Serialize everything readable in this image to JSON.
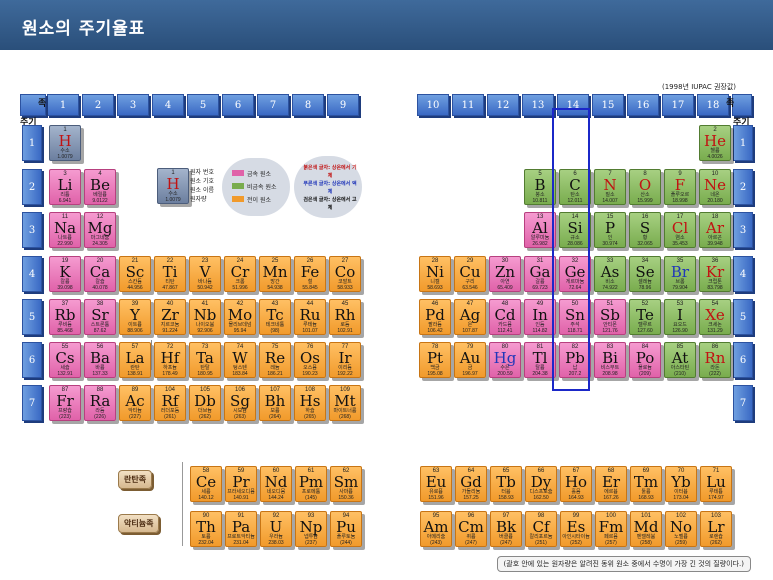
{
  "window": {
    "title": "원소의 주기율표"
  },
  "labels": {
    "group_caption": "족",
    "period_caption": "주기",
    "iupac_note": "(1998년 IUPAC 권장값)",
    "lanthanide_badge": "란탄족",
    "actinide_badge": "악티늄족",
    "footnote": "(괄호 안에 있는 원자량은 알려진 동위 원소 중에서 수명이 가장 긴 것의 질량이다.)"
  },
  "groups": [
    "1",
    "2",
    "3",
    "4",
    "5",
    "6",
    "7",
    "8",
    "9",
    "10",
    "11",
    "12",
    "13",
    "14",
    "15",
    "16",
    "17",
    "18"
  ],
  "periods": [
    "1",
    "2",
    "3",
    "4",
    "5",
    "6",
    "7"
  ],
  "legend": {
    "sample": {
      "number": "1",
      "symbol": "H",
      "name": "수소",
      "mass": "1.0079"
    },
    "lines": [
      "원자 번호",
      "원소 기호",
      "원소 이름",
      "원자량"
    ],
    "categories": [
      "금속 원소",
      "비금속 원소",
      "전이 원소"
    ],
    "color_notes": [
      "붉은색 글자: 상온에서 기체",
      "푸른색 글자: 상온에서 액체",
      "검은색 글자: 상온에서 고체"
    ],
    "colors": {
      "metal": "#e062a9",
      "nonmetal": "#79ac4e",
      "transition": "#f19a2b"
    }
  },
  "elements": [
    {
      "n": "1",
      "s": "H",
      "k": "수소",
      "m": "1.0079",
      "c": "gray",
      "t": "red"
    },
    {
      "n": "2",
      "s": "He",
      "k": "헬륨",
      "m": "4.0026",
      "c": "green",
      "t": "red"
    },
    {
      "n": "3",
      "s": "Li",
      "k": "리튬",
      "m": "6.941",
      "c": "pink",
      "t": "blk"
    },
    {
      "n": "4",
      "s": "Be",
      "k": "베릴륨",
      "m": "9.0122",
      "c": "pink",
      "t": "blk"
    },
    {
      "n": "5",
      "s": "B",
      "k": "붕소",
      "m": "10.811",
      "c": "green",
      "t": "blk"
    },
    {
      "n": "6",
      "s": "C",
      "k": "탄소",
      "m": "12.011",
      "c": "green",
      "t": "blk"
    },
    {
      "n": "7",
      "s": "N",
      "k": "질소",
      "m": "14.007",
      "c": "green",
      "t": "red"
    },
    {
      "n": "8",
      "s": "O",
      "k": "산소",
      "m": "15.999",
      "c": "green",
      "t": "red"
    },
    {
      "n": "9",
      "s": "F",
      "k": "플루오르",
      "m": "18.998",
      "c": "green",
      "t": "red"
    },
    {
      "n": "10",
      "s": "Ne",
      "k": "네온",
      "m": "20.180",
      "c": "green",
      "t": "red"
    },
    {
      "n": "11",
      "s": "Na",
      "k": "나트륨",
      "m": "22.990",
      "c": "pink",
      "t": "blk"
    },
    {
      "n": "12",
      "s": "Mg",
      "k": "마그네슘",
      "m": "24.305",
      "c": "pink",
      "t": "blk"
    },
    {
      "n": "13",
      "s": "Al",
      "k": "알루미늄",
      "m": "26.982",
      "c": "pink",
      "t": "blk"
    },
    {
      "n": "14",
      "s": "Si",
      "k": "규소",
      "m": "28.086",
      "c": "green",
      "t": "blk"
    },
    {
      "n": "15",
      "s": "P",
      "k": "인",
      "m": "30.974",
      "c": "green",
      "t": "blk"
    },
    {
      "n": "16",
      "s": "S",
      "k": "황",
      "m": "32.065",
      "c": "green",
      "t": "blk"
    },
    {
      "n": "17",
      "s": "Cl",
      "k": "염소",
      "m": "35.453",
      "c": "green",
      "t": "red"
    },
    {
      "n": "18",
      "s": "Ar",
      "k": "아르곤",
      "m": "39.948",
      "c": "green",
      "t": "red"
    },
    {
      "n": "19",
      "s": "K",
      "k": "칼륨",
      "m": "39.098",
      "c": "pink",
      "t": "blk"
    },
    {
      "n": "20",
      "s": "Ca",
      "k": "칼슘",
      "m": "40.078",
      "c": "pink",
      "t": "blk"
    },
    {
      "n": "21",
      "s": "Sc",
      "k": "스칸듐",
      "m": "44.956",
      "c": "orange",
      "t": "blk"
    },
    {
      "n": "22",
      "s": "Ti",
      "k": "티탄",
      "m": "47.867",
      "c": "orange",
      "t": "blk"
    },
    {
      "n": "23",
      "s": "V",
      "k": "바나듐",
      "m": "50.942",
      "c": "orange",
      "t": "blk"
    },
    {
      "n": "24",
      "s": "Cr",
      "k": "크롬",
      "m": "51.996",
      "c": "orange",
      "t": "blk"
    },
    {
      "n": "25",
      "s": "Mn",
      "k": "망간",
      "m": "54.938",
      "c": "orange",
      "t": "blk"
    },
    {
      "n": "26",
      "s": "Fe",
      "k": "철",
      "m": "55.845",
      "c": "orange",
      "t": "blk"
    },
    {
      "n": "27",
      "s": "Co",
      "k": "코발트",
      "m": "58.933",
      "c": "orange",
      "t": "blk"
    },
    {
      "n": "28",
      "s": "Ni",
      "k": "니켈",
      "m": "58.693",
      "c": "orange",
      "t": "blk"
    },
    {
      "n": "29",
      "s": "Cu",
      "k": "구리",
      "m": "63.546",
      "c": "orange",
      "t": "blk"
    },
    {
      "n": "30",
      "s": "Zn",
      "k": "아연",
      "m": "65.409",
      "c": "pink",
      "t": "blk"
    },
    {
      "n": "31",
      "s": "Ga",
      "k": "갈륨",
      "m": "69.723",
      "c": "pink",
      "t": "blk"
    },
    {
      "n": "32",
      "s": "Ge",
      "k": "게르마늄",
      "m": "72.64",
      "c": "pink",
      "t": "blk"
    },
    {
      "n": "33",
      "s": "As",
      "k": "비소",
      "m": "74.922",
      "c": "green",
      "t": "blk"
    },
    {
      "n": "34",
      "s": "Se",
      "k": "셀레늄",
      "m": "78.96",
      "c": "green",
      "t": "blk"
    },
    {
      "n": "35",
      "s": "Br",
      "k": "브롬",
      "m": "79.904",
      "c": "green",
      "t": "blue"
    },
    {
      "n": "36",
      "s": "Kr",
      "k": "크립톤",
      "m": "83.798",
      "c": "green",
      "t": "red"
    },
    {
      "n": "37",
      "s": "Rb",
      "k": "루비듐",
      "m": "85.468",
      "c": "pink",
      "t": "blk"
    },
    {
      "n": "38",
      "s": "Sr",
      "k": "스트론튬",
      "m": "87.62",
      "c": "pink",
      "t": "blk"
    },
    {
      "n": "39",
      "s": "Y",
      "k": "이트륨",
      "m": "88.906",
      "c": "orange",
      "t": "blk"
    },
    {
      "n": "40",
      "s": "Zr",
      "k": "지르코늄",
      "m": "91.224",
      "c": "orange",
      "t": "blk"
    },
    {
      "n": "41",
      "s": "Nb",
      "k": "나이오븀",
      "m": "92.906",
      "c": "orange",
      "t": "blk"
    },
    {
      "n": "42",
      "s": "Mo",
      "k": "몰리브데넘",
      "m": "95.94",
      "c": "orange",
      "t": "blk"
    },
    {
      "n": "43",
      "s": "Tc",
      "k": "테크네튬",
      "m": "(98)",
      "c": "orange",
      "t": "blk"
    },
    {
      "n": "44",
      "s": "Ru",
      "k": "루테늄",
      "m": "101.07",
      "c": "orange",
      "t": "blk"
    },
    {
      "n": "45",
      "s": "Rh",
      "k": "로듐",
      "m": "102.91",
      "c": "orange",
      "t": "blk"
    },
    {
      "n": "46",
      "s": "Pd",
      "k": "팔라듐",
      "m": "106.42",
      "c": "orange",
      "t": "blk"
    },
    {
      "n": "47",
      "s": "Ag",
      "k": "은",
      "m": "107.87",
      "c": "orange",
      "t": "blk"
    },
    {
      "n": "48",
      "s": "Cd",
      "k": "카드뮴",
      "m": "112.41",
      "c": "pink",
      "t": "blk"
    },
    {
      "n": "49",
      "s": "In",
      "k": "인듐",
      "m": "114.82",
      "c": "pink",
      "t": "blk"
    },
    {
      "n": "50",
      "s": "Sn",
      "k": "주석",
      "m": "118.71",
      "c": "pink",
      "t": "blk"
    },
    {
      "n": "51",
      "s": "Sb",
      "k": "안티몬",
      "m": "121.76",
      "c": "pink",
      "t": "blk"
    },
    {
      "n": "52",
      "s": "Te",
      "k": "텔루르",
      "m": "127.60",
      "c": "green",
      "t": "blk"
    },
    {
      "n": "53",
      "s": "I",
      "k": "요오드",
      "m": "126.90",
      "c": "green",
      "t": "blk"
    },
    {
      "n": "54",
      "s": "Xe",
      "k": "크세논",
      "m": "131.29",
      "c": "green",
      "t": "red"
    },
    {
      "n": "55",
      "s": "Cs",
      "k": "세슘",
      "m": "132.91",
      "c": "pink",
      "t": "blk"
    },
    {
      "n": "56",
      "s": "Ba",
      "k": "바륨",
      "m": "137.33",
      "c": "pink",
      "t": "blk"
    },
    {
      "n": "57",
      "s": "La",
      "k": "란탄",
      "m": "138.91",
      "c": "orange",
      "t": "blk"
    },
    {
      "n": "72",
      "s": "Hf",
      "k": "하프늄",
      "m": "178.49",
      "c": "orange",
      "t": "blk"
    },
    {
      "n": "73",
      "s": "Ta",
      "k": "탄탈",
      "m": "180.95",
      "c": "orange",
      "t": "blk"
    },
    {
      "n": "74",
      "s": "W",
      "k": "텅스텐",
      "m": "183.84",
      "c": "orange",
      "t": "blk"
    },
    {
      "n": "75",
      "s": "Re",
      "k": "레늄",
      "m": "186.21",
      "c": "orange",
      "t": "blk"
    },
    {
      "n": "76",
      "s": "Os",
      "k": "오스뮴",
      "m": "190.23",
      "c": "orange",
      "t": "blk"
    },
    {
      "n": "77",
      "s": "Ir",
      "k": "이리듐",
      "m": "192.22",
      "c": "orange",
      "t": "blk"
    },
    {
      "n": "78",
      "s": "Pt",
      "k": "백금",
      "m": "195.08",
      "c": "orange",
      "t": "blk"
    },
    {
      "n": "79",
      "s": "Au",
      "k": "금",
      "m": "196.97",
      "c": "orange",
      "t": "blk"
    },
    {
      "n": "80",
      "s": "Hg",
      "k": "수은",
      "m": "200.59",
      "c": "pink",
      "t": "blue"
    },
    {
      "n": "81",
      "s": "Tl",
      "k": "탈륨",
      "m": "204.38",
      "c": "pink",
      "t": "blk"
    },
    {
      "n": "82",
      "s": "Pb",
      "k": "납",
      "m": "207.2",
      "c": "pink",
      "t": "blk"
    },
    {
      "n": "83",
      "s": "Bi",
      "k": "비스무트",
      "m": "208.98",
      "c": "pink",
      "t": "blk"
    },
    {
      "n": "84",
      "s": "Po",
      "k": "폴로늄",
      "m": "(209)",
      "c": "pink",
      "t": "blk"
    },
    {
      "n": "85",
      "s": "At",
      "k": "아스타틴",
      "m": "(210)",
      "c": "green",
      "t": "blk"
    },
    {
      "n": "86",
      "s": "Rn",
      "k": "라돈",
      "m": "(222)",
      "c": "green",
      "t": "red"
    },
    {
      "n": "87",
      "s": "Fr",
      "k": "프랑슘",
      "m": "(223)",
      "c": "pink",
      "t": "blk"
    },
    {
      "n": "88",
      "s": "Ra",
      "k": "라듐",
      "m": "(226)",
      "c": "pink",
      "t": "blk"
    },
    {
      "n": "89",
      "s": "Ac",
      "k": "악티늄",
      "m": "(227)",
      "c": "orange",
      "t": "blk"
    },
    {
      "n": "104",
      "s": "Rf",
      "k": "러더포듐",
      "m": "(261)",
      "c": "orange",
      "t": "blk"
    },
    {
      "n": "105",
      "s": "Db",
      "k": "더브늄",
      "m": "(262)",
      "c": "orange",
      "t": "blk"
    },
    {
      "n": "106",
      "s": "Sg",
      "k": "시보귬",
      "m": "(263)",
      "c": "orange",
      "t": "blk"
    },
    {
      "n": "107",
      "s": "Bh",
      "k": "보륨",
      "m": "(264)",
      "c": "orange",
      "t": "blk"
    },
    {
      "n": "108",
      "s": "Hs",
      "k": "하슘",
      "m": "(265)",
      "c": "orange",
      "t": "blk"
    },
    {
      "n": "109",
      "s": "Mt",
      "k": "마이트너륨",
      "m": "(268)",
      "c": "orange",
      "t": "blk"
    }
  ],
  "lanthanides": [
    {
      "n": "58",
      "s": "Ce",
      "k": "세륨",
      "m": "140.12"
    },
    {
      "n": "59",
      "s": "Pr",
      "k": "프라세오디뮴",
      "m": "140.91"
    },
    {
      "n": "60",
      "s": "Nd",
      "k": "네오디뮴",
      "m": "144.24"
    },
    {
      "n": "61",
      "s": "Pm",
      "k": "프로메튬",
      "m": "(145)"
    },
    {
      "n": "62",
      "s": "Sm",
      "k": "사마륨",
      "m": "150.36"
    },
    {
      "n": "63",
      "s": "Eu",
      "k": "유로퓸",
      "m": "151.96"
    },
    {
      "n": "64",
      "s": "Gd",
      "k": "가돌리늄",
      "m": "157.25"
    },
    {
      "n": "65",
      "s": "Tb",
      "k": "터븀",
      "m": "158.93"
    },
    {
      "n": "66",
      "s": "Dy",
      "k": "디스프로슘",
      "m": "162.50"
    },
    {
      "n": "67",
      "s": "Ho",
      "k": "홀뮴",
      "m": "164.93"
    },
    {
      "n": "68",
      "s": "Er",
      "k": "에르븀",
      "m": "167.26"
    },
    {
      "n": "69",
      "s": "Tm",
      "k": "툴륨",
      "m": "168.93"
    },
    {
      "n": "70",
      "s": "Yb",
      "k": "이터븀",
      "m": "173.04"
    },
    {
      "n": "71",
      "s": "Lu",
      "k": "루테튬",
      "m": "174.97"
    }
  ],
  "actinides": [
    {
      "n": "90",
      "s": "Th",
      "k": "토륨",
      "m": "232.04"
    },
    {
      "n": "91",
      "s": "Pa",
      "k": "프로트악티늄",
      "m": "231.04"
    },
    {
      "n": "92",
      "s": "U",
      "k": "우라늄",
      "m": "238.03"
    },
    {
      "n": "93",
      "s": "Np",
      "k": "넵투늄",
      "m": "(237)"
    },
    {
      "n": "94",
      "s": "Pu",
      "k": "플루토늄",
      "m": "(244)"
    },
    {
      "n": "95",
      "s": "Am",
      "k": "아메리슘",
      "m": "(243)"
    },
    {
      "n": "96",
      "s": "Cm",
      "k": "퀴륨",
      "m": "(247)"
    },
    {
      "n": "97",
      "s": "Bk",
      "k": "버클륨",
      "m": "(247)"
    },
    {
      "n": "98",
      "s": "Cf",
      "k": "칼리포르늄",
      "m": "(251)"
    },
    {
      "n": "99",
      "s": "Es",
      "k": "아인시타이늄",
      "m": "(252)"
    },
    {
      "n": "100",
      "s": "Fm",
      "k": "페르뮴",
      "m": "(257)"
    },
    {
      "n": "101",
      "s": "Md",
      "k": "멘델레븀",
      "m": "(258)"
    },
    {
      "n": "102",
      "s": "No",
      "k": "노벨륨",
      "m": "(259)"
    },
    {
      "n": "103",
      "s": "Lr",
      "k": "로렌슘",
      "m": "(262)"
    }
  ]
}
